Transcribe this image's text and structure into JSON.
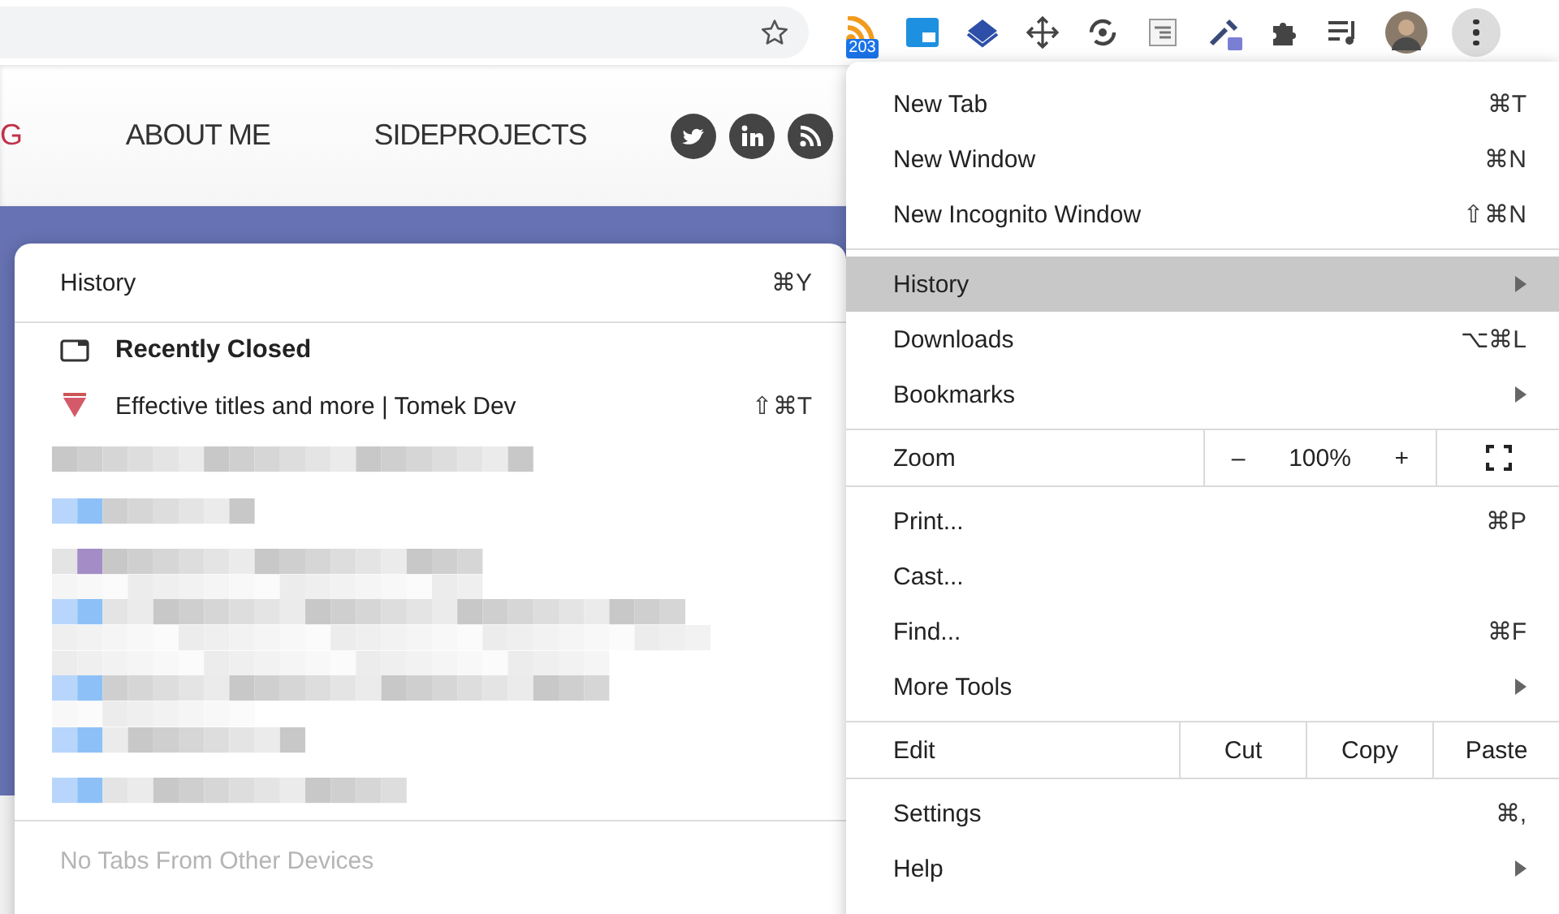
{
  "toolbar": {
    "badge": "203"
  },
  "site_nav": [
    {
      "label": "G",
      "selected": true
    },
    {
      "label": "ABOUT ME",
      "selected": false
    },
    {
      "label": "SIDEPROJECTS",
      "selected": false
    }
  ],
  "history_menu": {
    "title": "History",
    "shortcut": "⌘Y",
    "section": "Recently Closed",
    "entries": [
      {
        "title": "Effective titles and more | Tomek Dev",
        "shortcut": "⇧⌘T"
      }
    ],
    "footer": {
      "label": "No Tabs From Other Devices",
      "disabled": true
    }
  },
  "menu": [
    {
      "kind": "item",
      "label": "New Tab",
      "shortcut": "⌘T",
      "submenu": false,
      "selected": false
    },
    {
      "kind": "item",
      "label": "New Window",
      "shortcut": "⌘N",
      "submenu": false,
      "selected": false
    },
    {
      "kind": "item",
      "label": "New Incognito Window",
      "shortcut": "⇧⌘N",
      "submenu": false,
      "selected": false
    },
    {
      "kind": "separator"
    },
    {
      "kind": "item",
      "label": "History",
      "submenu": true,
      "selected": true
    },
    {
      "kind": "item",
      "label": "Downloads",
      "shortcut": "⌥⌘L",
      "submenu": false,
      "selected": false
    },
    {
      "kind": "item",
      "label": "Bookmarks",
      "submenu": true,
      "selected": false
    },
    {
      "kind": "separator"
    },
    {
      "kind": "zoom",
      "label": "Zoom",
      "minus": "–",
      "value": "100%",
      "plus": "+"
    },
    {
      "kind": "separator"
    },
    {
      "kind": "item",
      "label": "Print...",
      "shortcut": "⌘P",
      "submenu": false,
      "selected": false
    },
    {
      "kind": "item",
      "label": "Cast...",
      "submenu": false,
      "selected": false
    },
    {
      "kind": "item",
      "label": "Find...",
      "shortcut": "⌘F",
      "submenu": false,
      "selected": false
    },
    {
      "kind": "item",
      "label": "More Tools",
      "submenu": true,
      "selected": false
    },
    {
      "kind": "separator"
    },
    {
      "kind": "edit",
      "label": "Edit",
      "actions": [
        "Cut",
        "Copy",
        "Paste"
      ]
    },
    {
      "kind": "separator"
    },
    {
      "kind": "item",
      "label": "Settings",
      "shortcut": "⌘,",
      "submenu": false,
      "selected": false
    },
    {
      "kind": "item",
      "label": "Help",
      "submenu": true,
      "selected": false
    }
  ]
}
